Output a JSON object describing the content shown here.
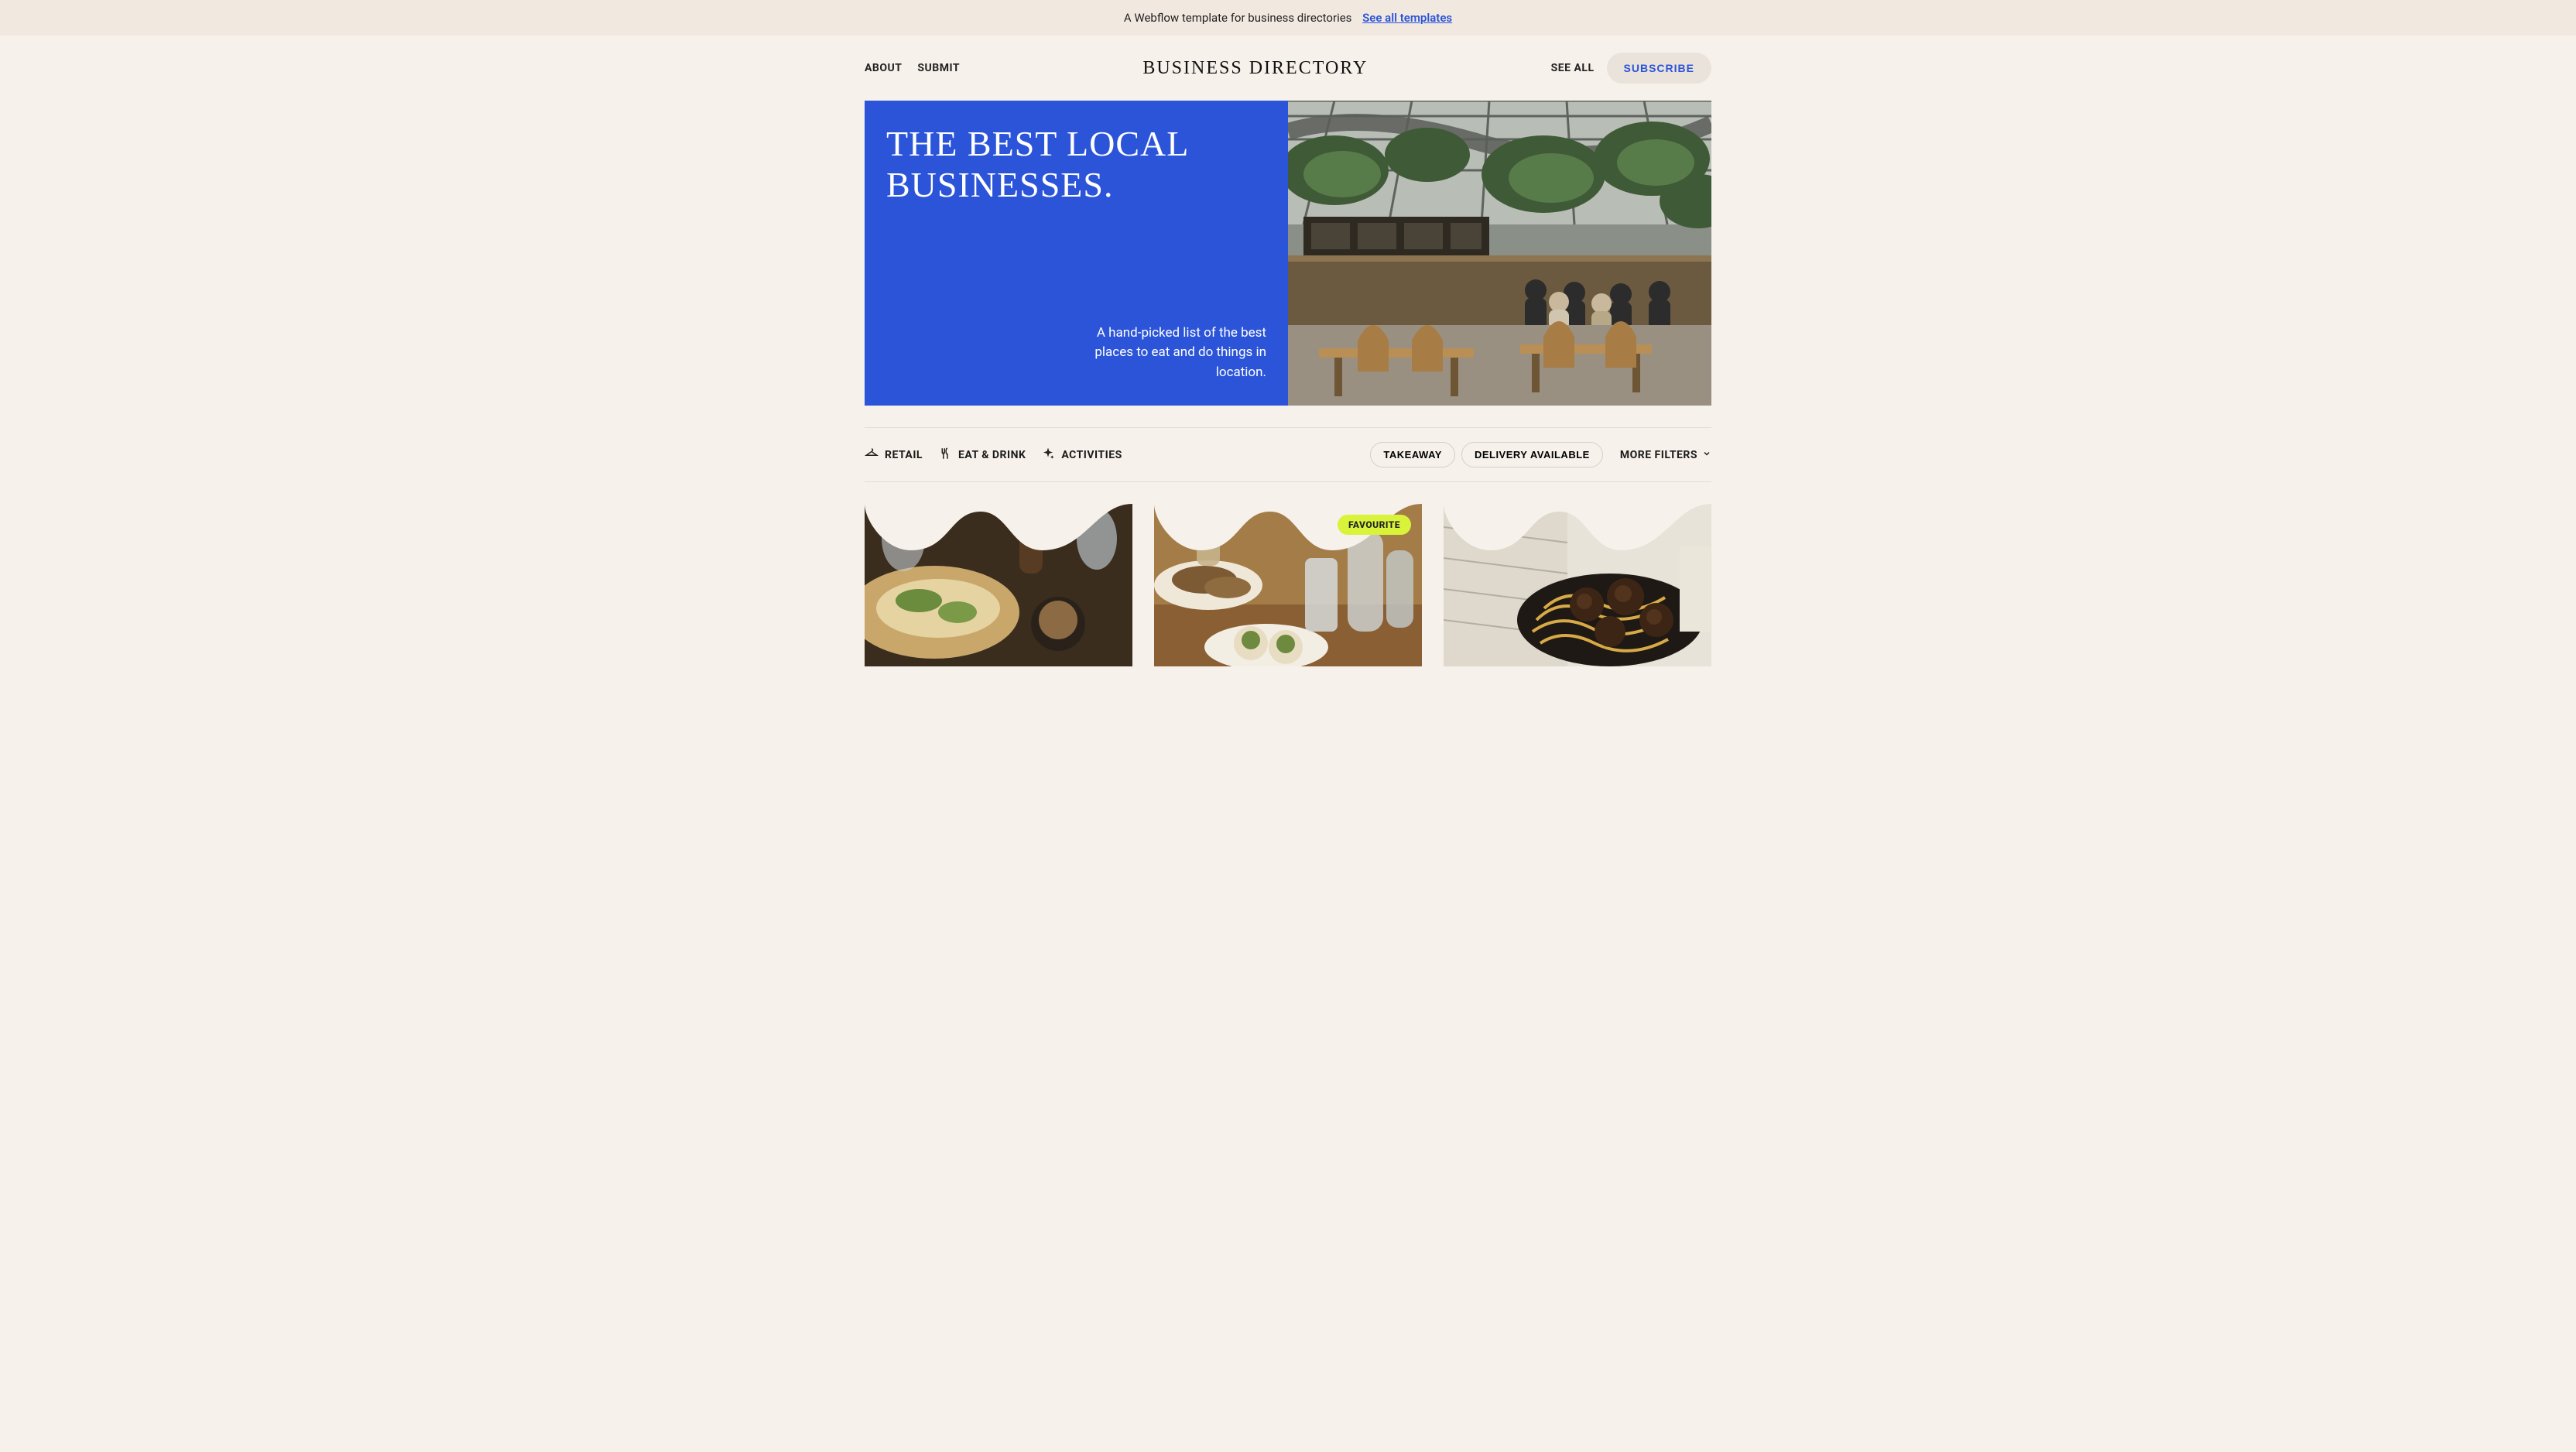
{
  "announce": {
    "text": "A Webflow template for business directories",
    "link_label": "See all templates"
  },
  "header": {
    "nav_left": {
      "about": "ABOUT",
      "submit": "SUBMIT"
    },
    "logo": "BUSINESS DIRECTORY",
    "nav_right": {
      "see_all": "SEE ALL",
      "subscribe": "SUBSCRIBE"
    }
  },
  "hero": {
    "title": "THE BEST LOCAL BUSINESSES.",
    "subtitle": "A hand-picked list of the best places to eat and do things in location."
  },
  "filters": {
    "categories": {
      "retail": "RETAIL",
      "eatdrink": "EAT & DRINK",
      "activities": "ACTIVITIES"
    },
    "pills": {
      "takeaway": "TAKEAWAY",
      "delivery": "DELIVERY AVAILABLE"
    },
    "more": "MORE FILTERS"
  },
  "cards": {
    "favourite_label": "FAVOURITE"
  }
}
